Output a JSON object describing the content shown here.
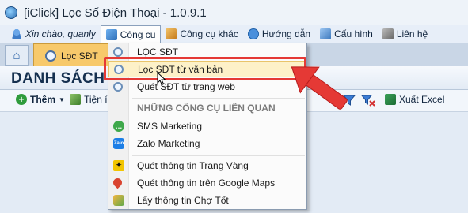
{
  "window": {
    "title": "[iClick] Lọc Số Điện Thoại - 1.0.9.1"
  },
  "menubar": {
    "greeting": "Xin chào, quanly",
    "items": [
      {
        "label": "Công cụ",
        "icon": "tools-icon"
      },
      {
        "label": "Công cụ khác",
        "icon": "other-tools-icon"
      },
      {
        "label": "Hướng dẫn",
        "icon": "help-icon"
      },
      {
        "label": "Cấu hình",
        "icon": "config-icon"
      },
      {
        "label": "Liên hệ",
        "icon": "phone-icon"
      }
    ]
  },
  "tabs": {
    "active": "Lọc SĐT"
  },
  "content": {
    "heading": "DANH SÁCH S"
  },
  "toolbar": {
    "add_label": "Thêm",
    "utility_label": "Tiện íc",
    "export_label": "Xuất Excel"
  },
  "dropdown": {
    "items": [
      {
        "label": "LỌC SĐT",
        "icon": "search-icon"
      },
      {
        "label": "Lọc SĐT từ văn bản",
        "icon": "search-icon"
      },
      {
        "label": "Quét SĐT từ trang web",
        "icon": "search-icon"
      }
    ],
    "section_label": "NHỮNG CÔNG CỤ LIÊN QUAN",
    "related": [
      {
        "label": "SMS Marketing",
        "icon": "sms-icon"
      },
      {
        "label": "Zalo Marketing",
        "icon": "zalo-icon"
      },
      {
        "label": "Quét thông tin Trang Vàng",
        "icon": "yellow-pages-icon"
      },
      {
        "label": "Quét thông tin trên Google Maps",
        "icon": "map-pin-icon"
      },
      {
        "label": "Lấy thông tin Chợ Tốt",
        "icon": "chotot-icon"
      }
    ]
  },
  "colors": {
    "highlight": "#e53935",
    "active_tab": "#f7c96b",
    "selected_row": "#fdf1c8"
  }
}
